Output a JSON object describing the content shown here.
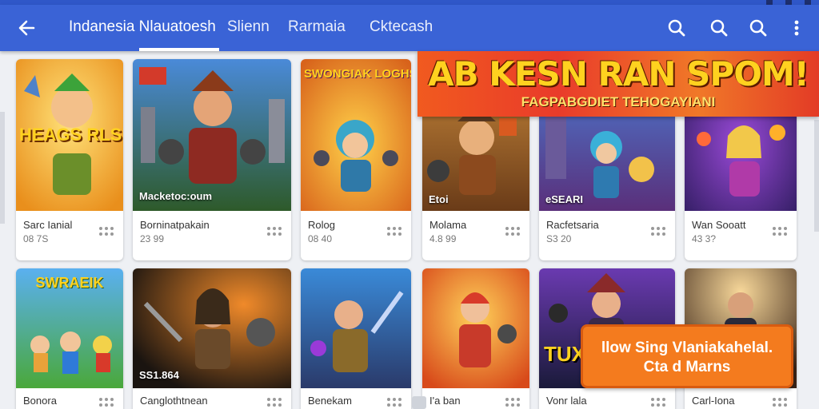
{
  "header": {
    "tabs": [
      {
        "label": "Indanesia Nlauatoesh",
        "active": true
      },
      {
        "label": "Slienn"
      },
      {
        "label": "Rarmaia"
      },
      {
        "label": "Cktecash"
      }
    ],
    "actions": [
      "search-icon",
      "search-icon",
      "search-icon",
      "more-vert-icon"
    ]
  },
  "colors": {
    "appbar": "#3a63d6",
    "promo": "#f15a1f",
    "cta": "#f47b1e",
    "background": "#eef0f4"
  },
  "promo": {
    "title": "AB KESN RAN SPOM!",
    "subtitle": "FAGPABGDIET TEHOGAYIANI"
  },
  "row1": [
    {
      "title": "Sarc Ianial",
      "rating": "08 7S",
      "thumb_text": "HEAGS RLSES"
    },
    {
      "title": "Borninatpakain",
      "rating": "23 99",
      "overlay": "Macketoc:oum"
    },
    {
      "title": "Rolog",
      "rating": "08 40",
      "thumb_text": "SWONGIAK LOGHSLAN"
    },
    {
      "title": "Molama",
      "rating": "4.8 99",
      "overlay": "Etoi"
    },
    {
      "title": "Racfetsaria",
      "rating": "S3 20",
      "overlay": "eSEARI"
    },
    {
      "title": "Wan Sooatt",
      "rating": "43 3?"
    }
  ],
  "row2": [
    {
      "title": "Bonora",
      "thumb_text": "SWRAEIK"
    },
    {
      "title": "Canglothtnean",
      "overlay": "SS1.864"
    },
    {
      "title": "Benekam"
    },
    {
      "title": "I'a ban"
    },
    {
      "title": "Vonr lala",
      "thumb_text": "TUX"
    },
    {
      "title": "Carl-Iona"
    }
  ],
  "cta": {
    "line1": "llow Sing Vlaniakahelal.",
    "line2": "Cta d Marns"
  }
}
